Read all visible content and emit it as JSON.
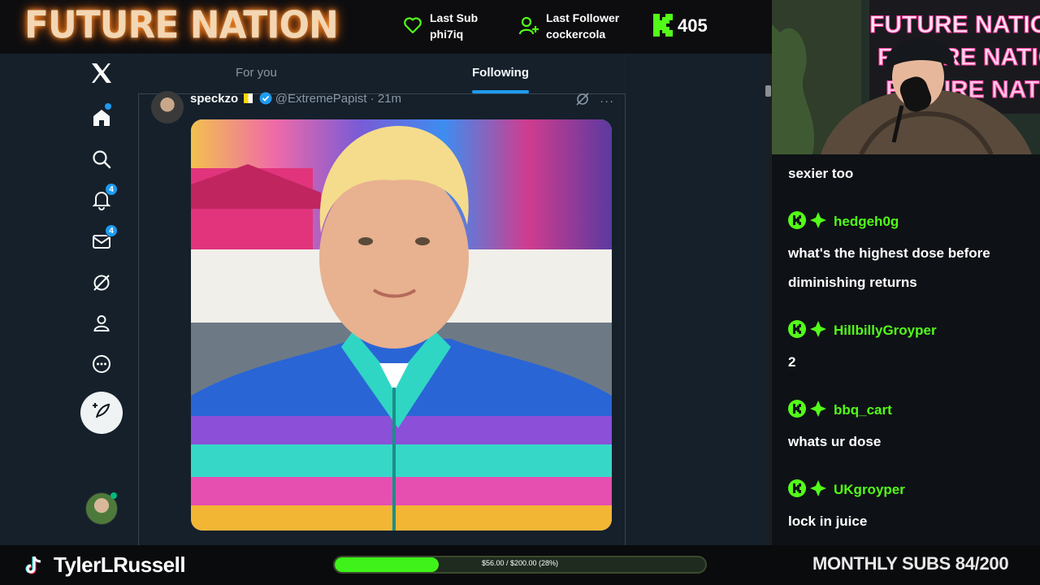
{
  "overlay": {
    "brand": "FUTURE NATION",
    "last_sub_label": "Last Sub",
    "last_sub_value": "phi7iq",
    "last_follower_label": "Last Follower",
    "last_follower_value": "cockercola",
    "kick_count": "405",
    "accent": "#53fc18"
  },
  "x": {
    "tabs": [
      "For you",
      "Following"
    ],
    "active_tab": "Following",
    "notification_badge": "4",
    "messages_badge": "4",
    "tweet": {
      "display_name": "speckzo",
      "handle": "@ExtremePapist",
      "time": "· 21m"
    }
  },
  "chat": {
    "messages": [
      {
        "user": "",
        "text": "sexier too"
      },
      {
        "user": "hedgeh0g",
        "text": "what's the highest dose before diminishing returns"
      },
      {
        "user": "HillbillyGroyper",
        "text": "2"
      },
      {
        "user": "bbq_cart",
        "text": "whats ur dose"
      },
      {
        "user": "UKgroyper",
        "text": "lock in juice"
      }
    ]
  },
  "footer": {
    "handle": "TylerLRussell",
    "goal_text": "$56.00 / $200.00 (28%)",
    "goal_fraction": 0.28,
    "monthly_subs": "MONTHLY SUBS 84/200"
  }
}
